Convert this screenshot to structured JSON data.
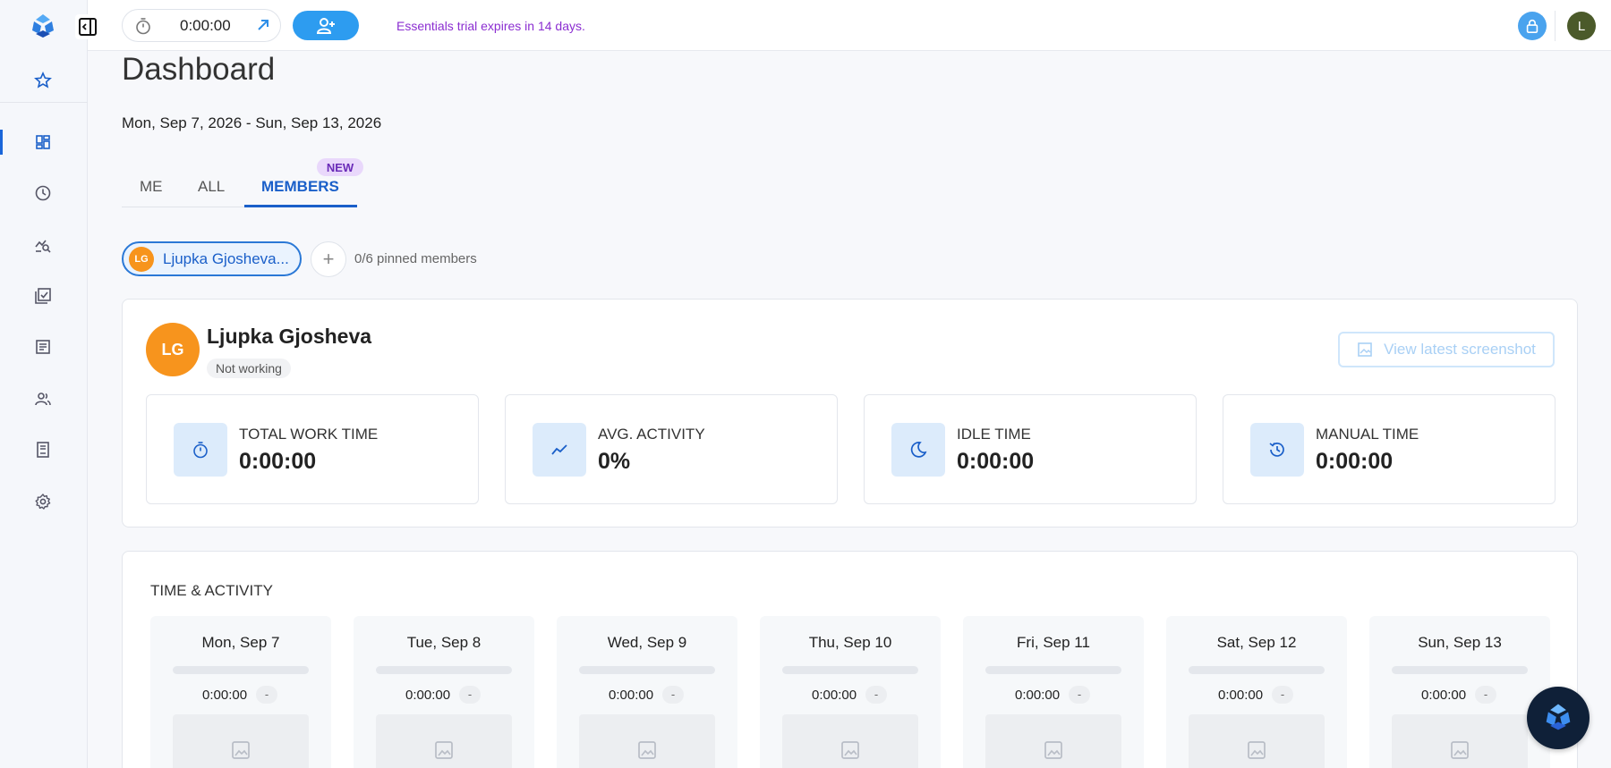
{
  "colors": {
    "accent": "#1a5fc9",
    "button": "#2d9cf0",
    "trial_text": "#8b2ed1",
    "avatar_orange": "#f7941d"
  },
  "sidebar": {
    "logo": "app-logo-icon",
    "items": [
      {
        "name": "favorites",
        "icon": "star-icon"
      },
      {
        "name": "dashboard",
        "icon": "dashboard-icon",
        "active": true
      },
      {
        "name": "timesheets",
        "icon": "clock-icon"
      },
      {
        "name": "activity",
        "icon": "chart-search-icon"
      },
      {
        "name": "projects",
        "icon": "checklist-icon"
      },
      {
        "name": "reports",
        "icon": "document-icon"
      },
      {
        "name": "people",
        "icon": "people-icon"
      },
      {
        "name": "invoices",
        "icon": "invoice-icon"
      },
      {
        "name": "settings",
        "icon": "gear-icon"
      }
    ]
  },
  "topbar": {
    "timer_value": "0:00:00",
    "trial_notice": "Essentials trial expires in 14 days.",
    "user_initial": "L"
  },
  "main": {
    "title": "Dashboard",
    "date_range": "Mon, Sep 7, 2026 - Sun, Sep 13, 2026",
    "tabs": [
      {
        "label": "ME"
      },
      {
        "label": "ALL"
      },
      {
        "label": "MEMBERS",
        "active": true
      }
    ],
    "new_badge": "NEW",
    "member_chip": {
      "initials": "LG",
      "name": "Ljupka Gjosheva..."
    },
    "pinned_text": "0/6 pinned members",
    "profile": {
      "initials": "LG",
      "name": "Ljupka Gjosheva",
      "status": "Not working",
      "screenshot_button": "View latest screenshot"
    },
    "stats": [
      {
        "label": "TOTAL WORK TIME",
        "value": "0:00:00",
        "icon": "stopwatch-icon"
      },
      {
        "label": "AVG. ACTIVITY",
        "value": "0%",
        "icon": "trend-icon"
      },
      {
        "label": "IDLE TIME",
        "value": "0:00:00",
        "icon": "moon-icon"
      },
      {
        "label": "MANUAL TIME",
        "value": "0:00:00",
        "icon": "history-icon"
      }
    ],
    "activity": {
      "title": "TIME & ACTIVITY",
      "days": [
        {
          "name": "Mon, Sep 7",
          "time": "0:00:00",
          "activity": "-"
        },
        {
          "name": "Tue, Sep 8",
          "time": "0:00:00",
          "activity": "-"
        },
        {
          "name": "Wed, Sep 9",
          "time": "0:00:00",
          "activity": "-"
        },
        {
          "name": "Thu, Sep 10",
          "time": "0:00:00",
          "activity": "-"
        },
        {
          "name": "Fri, Sep 11",
          "time": "0:00:00",
          "activity": "-"
        },
        {
          "name": "Sat, Sep 12",
          "time": "0:00:00",
          "activity": "-"
        },
        {
          "name": "Sun, Sep 13",
          "time": "0:00:00",
          "activity": "-"
        }
      ]
    }
  }
}
